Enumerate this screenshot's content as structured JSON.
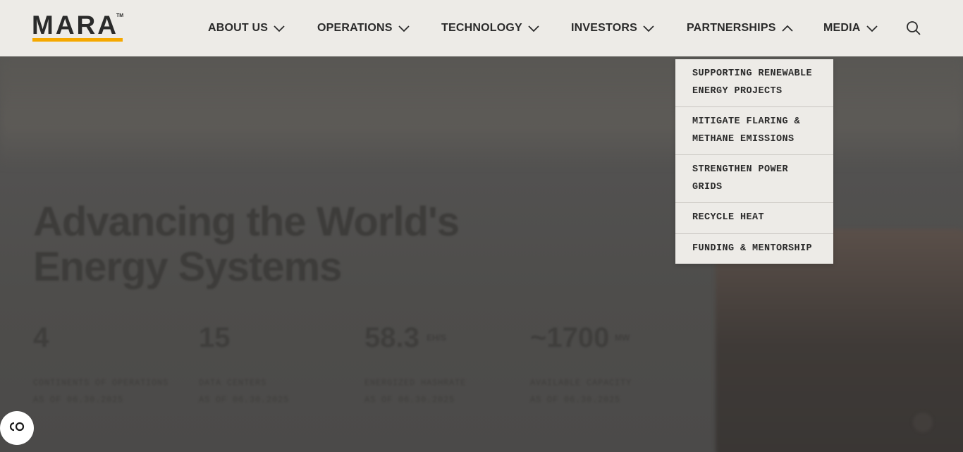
{
  "brand": {
    "name": "MARA",
    "tm": "TM",
    "accent": "#f5a800"
  },
  "nav": {
    "about": "ABOUT US",
    "operations": "OPERATIONS",
    "technology": "TECHNOLOGY",
    "investors": "INVESTORS",
    "partnerships": "PARTNERSHIPS",
    "media": "MEDIA",
    "search_icon": "search-icon"
  },
  "dropdown": {
    "items": [
      {
        "label": "SUPPORTING RENEWABLE ENERGY PROJECTS"
      },
      {
        "label": "MITIGATE FLARING & METHANE EMISSIONS"
      },
      {
        "label": "STRENGTHEN POWER GRIDS"
      },
      {
        "label": "RECYCLE HEAT"
      },
      {
        "label": "FUNDING & MENTORSHIP"
      }
    ]
  },
  "hero": {
    "title": "Advancing the World's Energy Systems",
    "stats": [
      {
        "value": "4",
        "unit": "",
        "label": "CONTINENTS OF OPERATIONS",
        "date": "AS OF 06.30.2025"
      },
      {
        "value": "15",
        "unit": "",
        "label": "DATA CENTERS",
        "date": "AS OF 06.30.2025"
      },
      {
        "value": "58.3",
        "unit": "EH/S",
        "label": "ENERGIZED HASHRATE",
        "date": "AS OF 06.30.2025"
      },
      {
        "value": "~1700",
        "unit": "MW",
        "label": "AVAILABLE CAPACITY",
        "date": "AS OF 06.30.2025"
      }
    ]
  },
  "a11y": {
    "icon": "accessibility-icon"
  }
}
